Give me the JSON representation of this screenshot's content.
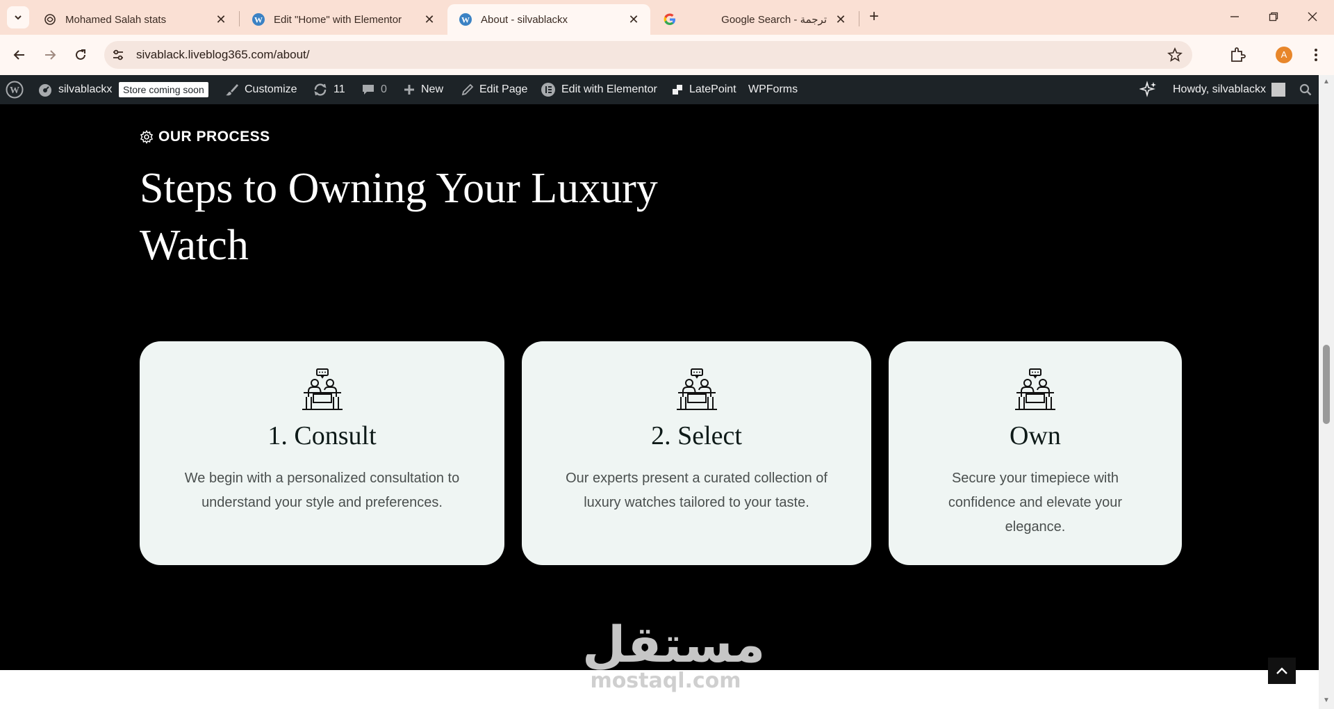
{
  "browser": {
    "tabs": [
      {
        "title": "Mohamed Salah stats",
        "icon": "chatgpt-icon",
        "active": false
      },
      {
        "title": "Edit \"Home\" with Elementor",
        "icon": "wordpress-icon",
        "active": false
      },
      {
        "title": "About - silvablackx",
        "icon": "wordpress-icon",
        "active": true
      },
      {
        "title": "Google Search - ترجمة",
        "icon": "google-icon",
        "active": false
      }
    ],
    "url": "sivablack.liveblog365.com/about/",
    "profile_initial": "A"
  },
  "adminbar": {
    "site_name": "silvablackx",
    "store_badge": "Store coming soon",
    "customize": "Customize",
    "updates_count": "11",
    "comments_count": "0",
    "new_label": "New",
    "edit_page": "Edit Page",
    "edit_elementor": "Edit with Elementor",
    "latepoint": "LatePoint",
    "wpforms": "WPForms",
    "howdy": "Howdy, silvablackx"
  },
  "page": {
    "eyebrow": "OUR PROCESS",
    "heading": "Steps to Owning Your Luxury Watch",
    "cards": [
      {
        "title": "1. Consult",
        "text": "We begin with a personalized consultation to understand your style and preferences.",
        "icon": "consultation-icon"
      },
      {
        "title": "2. Select",
        "text": "Our experts present a curated collection of luxury watches tailored to your taste.",
        "icon": "consultation-icon"
      },
      {
        "title": "Own",
        "text": "Secure your timepiece with confidence and elevate your elegance.",
        "icon": "consultation-icon"
      }
    ]
  },
  "watermark": {
    "arabic": "مستقل",
    "latin": "mostaql.com"
  },
  "colors": {
    "tabstrip": "#fae0d4",
    "toolbar": "#fff7f3",
    "adminbar": "#1d2327",
    "page_bg": "#000000",
    "card_bg": "#eff5f3",
    "avatar": "#e8862a"
  }
}
